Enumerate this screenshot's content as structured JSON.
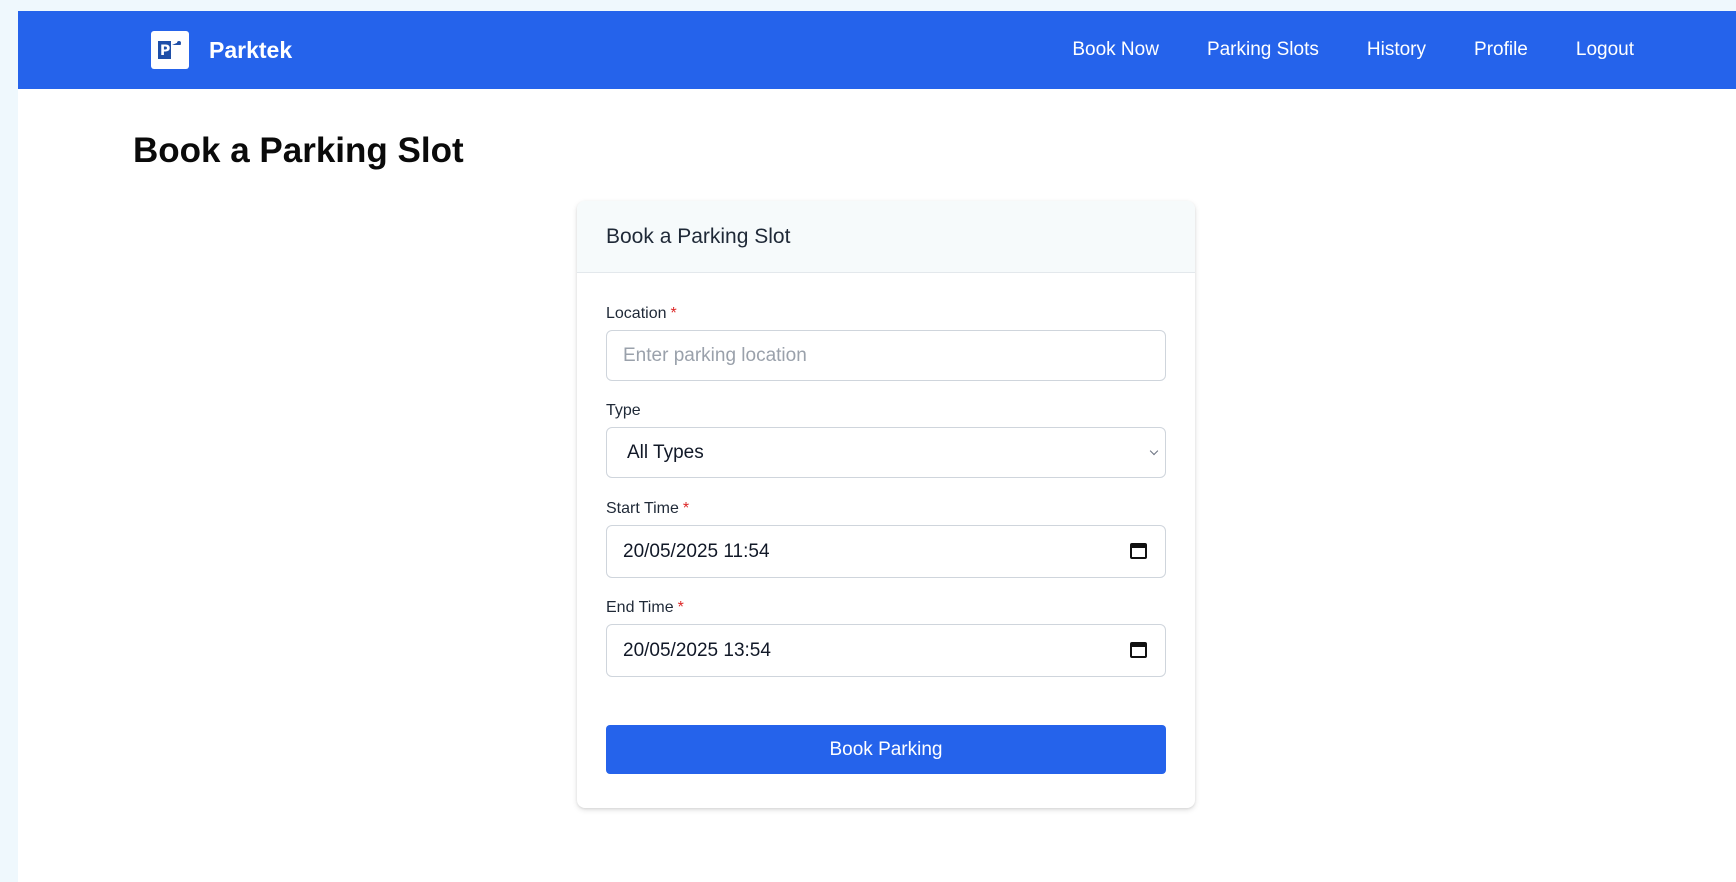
{
  "app": {
    "name": "Parktek",
    "logo_letter": "P"
  },
  "nav": {
    "items": [
      {
        "label": "Book Now"
      },
      {
        "label": "Parking Slots"
      },
      {
        "label": "History"
      },
      {
        "label": "Profile"
      },
      {
        "label": "Logout"
      }
    ]
  },
  "page": {
    "title": "Book a Parking Slot"
  },
  "form": {
    "header": "Book a Parking Slot",
    "location": {
      "label": "Location",
      "required_mark": "*",
      "placeholder": "Enter parking location",
      "value": ""
    },
    "type": {
      "label": "Type",
      "selected": "All Types"
    },
    "start_time": {
      "label": "Start Time",
      "required_mark": "*",
      "value": "20/05/2025 11:54"
    },
    "end_time": {
      "label": "End Time",
      "required_mark": "*",
      "value": "20/05/2025 13:54"
    },
    "submit_label": "Book Parking"
  },
  "icons": {
    "logo": "parking-logo-icon",
    "select": "chevron-down-icon",
    "date": "calendar-icon"
  },
  "colors": {
    "primary": "#2563eb",
    "required": "#dc2626",
    "page_background": "#eff8fd"
  }
}
